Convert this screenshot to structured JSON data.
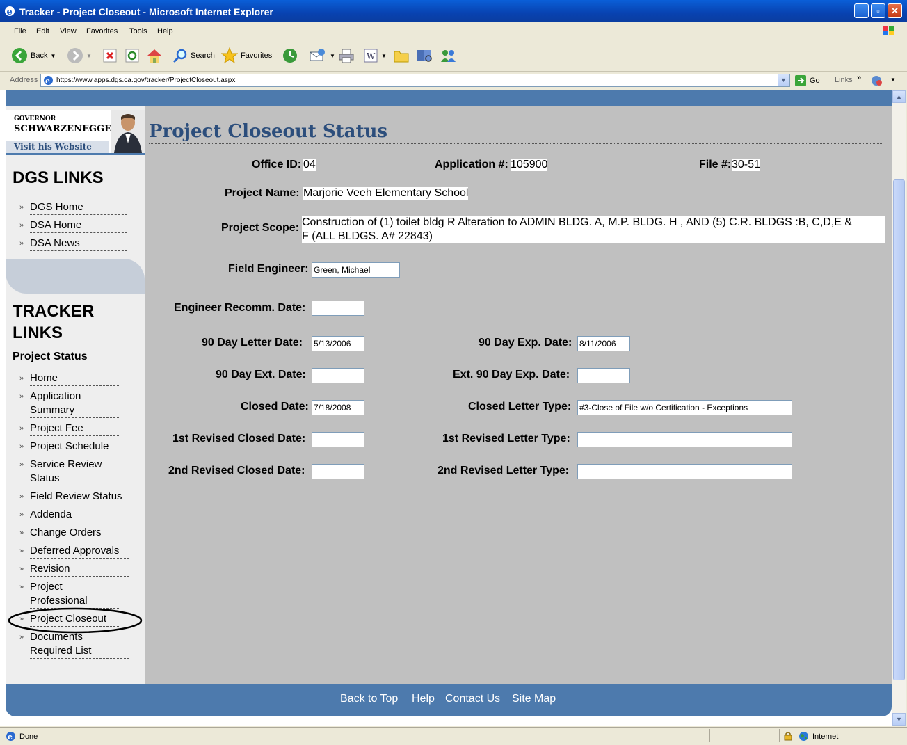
{
  "window": {
    "title": "Tracker - Project Closeout - Microsoft Internet Explorer"
  },
  "menu": {
    "file": "File",
    "edit": "Edit",
    "view": "View",
    "favorites": "Favorites",
    "tools": "Tools",
    "help": "Help"
  },
  "toolbar": {
    "back": "Back",
    "search": "Search",
    "favorites": "Favorites"
  },
  "address": {
    "label": "Address",
    "url": "https://www.apps.dgs.ca.gov/tracker/ProjectCloseout.aspx",
    "go": "Go",
    "links": "Links"
  },
  "gov": {
    "line1": "GOVERNOR",
    "line2": "SCHWARZENEGGER",
    "visit": "Visit his Website"
  },
  "dgs_links": {
    "heading": "DGS LINKS",
    "items": [
      "DGS Home",
      "DSA Home",
      "DSA News"
    ]
  },
  "tracker_links": {
    "heading1": "TRACKER",
    "heading2": "LINKS",
    "subheading": "Project Status",
    "items": [
      {
        "l1": "Home",
        "l2": ""
      },
      {
        "l1": "Application",
        "l2": "Summary"
      },
      {
        "l1": "Project Fee",
        "l2": ""
      },
      {
        "l1": "Project Schedule",
        "l2": ""
      },
      {
        "l1": "Service Review",
        "l2": "Status"
      },
      {
        "l1": "Field Review Status",
        "l2": ""
      },
      {
        "l1": "Addenda",
        "l2": ""
      },
      {
        "l1": "Change Orders",
        "l2": ""
      },
      {
        "l1": "Deferred Approvals",
        "l2": ""
      },
      {
        "l1": "Revision",
        "l2": ""
      },
      {
        "l1": "Project",
        "l2": "Professional"
      },
      {
        "l1": "Project Closeout",
        "l2": ""
      },
      {
        "l1": "Documents",
        "l2": "Required List"
      }
    ]
  },
  "page": {
    "title": "Project Closeout Status",
    "office_id_label": "Office ID:",
    "office_id": "04",
    "application_label": "Application #:",
    "application": "105900",
    "file_label": "File #:",
    "file": "30-51",
    "project_name_label": "Project Name:",
    "project_name": "Marjorie Veeh Elementary School",
    "project_scope_label": "Project Scope:",
    "project_scope_line1": "Construction of (1) toilet bldg R Alteration to ADMIN BLDG. A, M.P. BLDG. H , AND (5) C.R. BLDGS :B, C,D,E &",
    "project_scope_line2": "F (ALL BLDGS. A# 22843)",
    "field_engineer_label": "Field Engineer:",
    "field_engineer": "Green, Michael",
    "engineer_recomm_label": "Engineer Recomm. Date:",
    "engineer_recomm": "",
    "letter_90_label": "90 Day Letter Date:",
    "letter_90": "5/13/2006",
    "exp_90_label": "90 Day Exp. Date:",
    "exp_90": "8/11/2006",
    "ext_90_label": "90 Day Ext. Date:",
    "ext_90": "",
    "ext_exp_90_label": "Ext. 90 Day Exp. Date:",
    "ext_exp_90": "",
    "closed_date_label": "Closed Date:",
    "closed_date": "7/18/2008",
    "closed_letter_label": "Closed Letter Type:",
    "closed_letter": "#3-Close of File w/o Certification - Exceptions",
    "rev1_closed_label": "1st Revised Closed Date:",
    "rev1_closed": "",
    "rev1_letter_label": "1st Revised Letter Type:",
    "rev1_letter": "",
    "rev2_closed_label": "2nd Revised Closed Date:",
    "rev2_closed": "",
    "rev2_letter_label": "2nd Revised Letter Type:",
    "rev2_letter": ""
  },
  "footer": {
    "back_to_top": "Back to Top",
    "help": "Help",
    "contact": "Contact Us",
    "sitemap": "Site Map"
  },
  "status": {
    "text": "Done",
    "zone": "Internet"
  }
}
